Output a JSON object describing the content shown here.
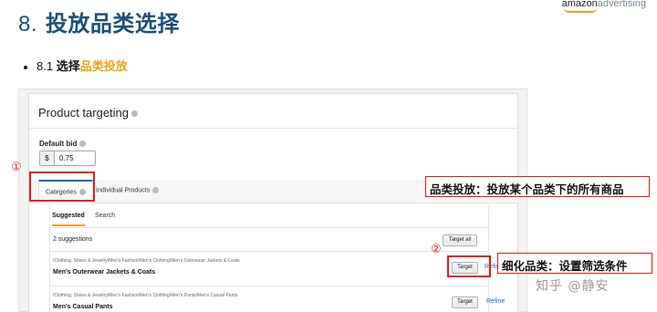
{
  "slide": {
    "title_num": "8.",
    "title_text": "投放品类选择",
    "logo_amazon": "amazon",
    "logo_advertising": "advertising",
    "bullet_num": "8.1",
    "bullet_text": "选择",
    "bullet_highlight": "品类投放"
  },
  "ui": {
    "card_title": "Product targeting",
    "default_bid_label": "Default bid",
    "currency": "$",
    "bid_value": "0.75",
    "tabs": [
      "Categories",
      "Individual Products"
    ],
    "subtabs": [
      "Suggested",
      "Search"
    ],
    "suggestion_count": "2 suggestions",
    "target_all_label": "Target all",
    "rows": [
      {
        "path": "/Clothing, Shoes & Jewelry/Men's Fashion/Men's Clothing/Men's Outerwear Jackets & Coats",
        "name": "Men's Outerwear Jackets & Coats",
        "target_label": "Target",
        "refine_label": "Refine"
      },
      {
        "path": "/Clothing, Shoes & Jewelry/Men's Fashion/Men's Clothing/Men's Pants/Men's Casual Pants",
        "name": "Men's Casual Pants",
        "target_label": "Target",
        "refine_label": "Refine"
      }
    ]
  },
  "annotations": {
    "marker1": "①",
    "marker2": "②",
    "callout1": "品类投放：投放某个品类下的所有商品",
    "callout2": "细化品类：设置筛选条件",
    "color": "#e31c1c"
  },
  "watermark": "知乎 @静安"
}
